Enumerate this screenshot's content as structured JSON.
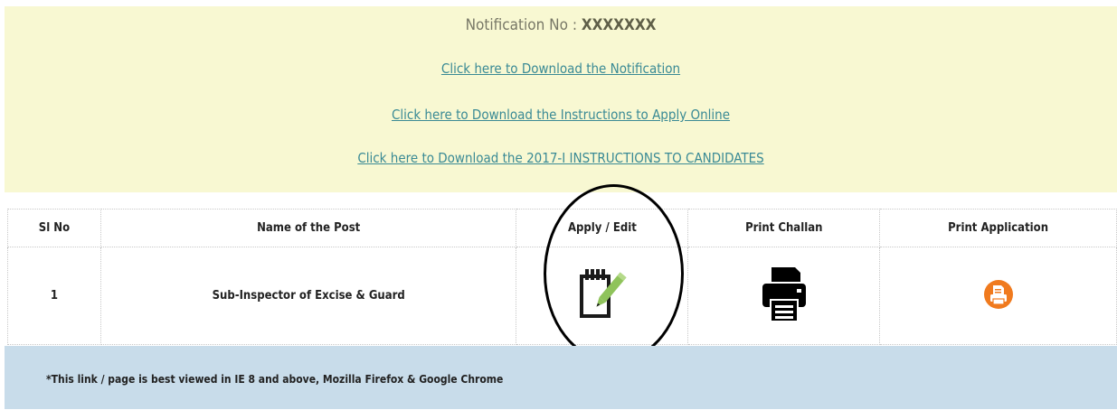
{
  "notice": {
    "title_label": "Notification No :",
    "title_value": "XXXXXXX",
    "link_notification": "Click here to Download the Notification",
    "link_instructions": "Click here to Download the Instructions to Apply Online",
    "link_candidates": "Click here to Download the 2017-I INSTRUCTIONS TO CANDIDATES"
  },
  "table": {
    "headers": {
      "sl_no": "Sl No",
      "post": "Name of the Post",
      "apply": "Apply / Edit",
      "challan": "Print Challan",
      "application": "Print Application"
    },
    "rows": [
      {
        "sl_no": "1",
        "post": "Sub-Inspector of Excise & Guard",
        "apply_icon": "notepad-pencil-icon",
        "challan_icon": "printer-icon",
        "application_icon": "print-document-icon"
      }
    ]
  },
  "footer": {
    "note": "*This link / page is best viewed in IE 8 and above, Mozilla Firefox & Google Chrome"
  },
  "colors": {
    "notice_bg": "#f8f8d2",
    "link": "#3a8a95",
    "footer_bg": "#c8dcea",
    "pencil_green": "#8fc35b",
    "print_orange": "#f07a1e"
  }
}
